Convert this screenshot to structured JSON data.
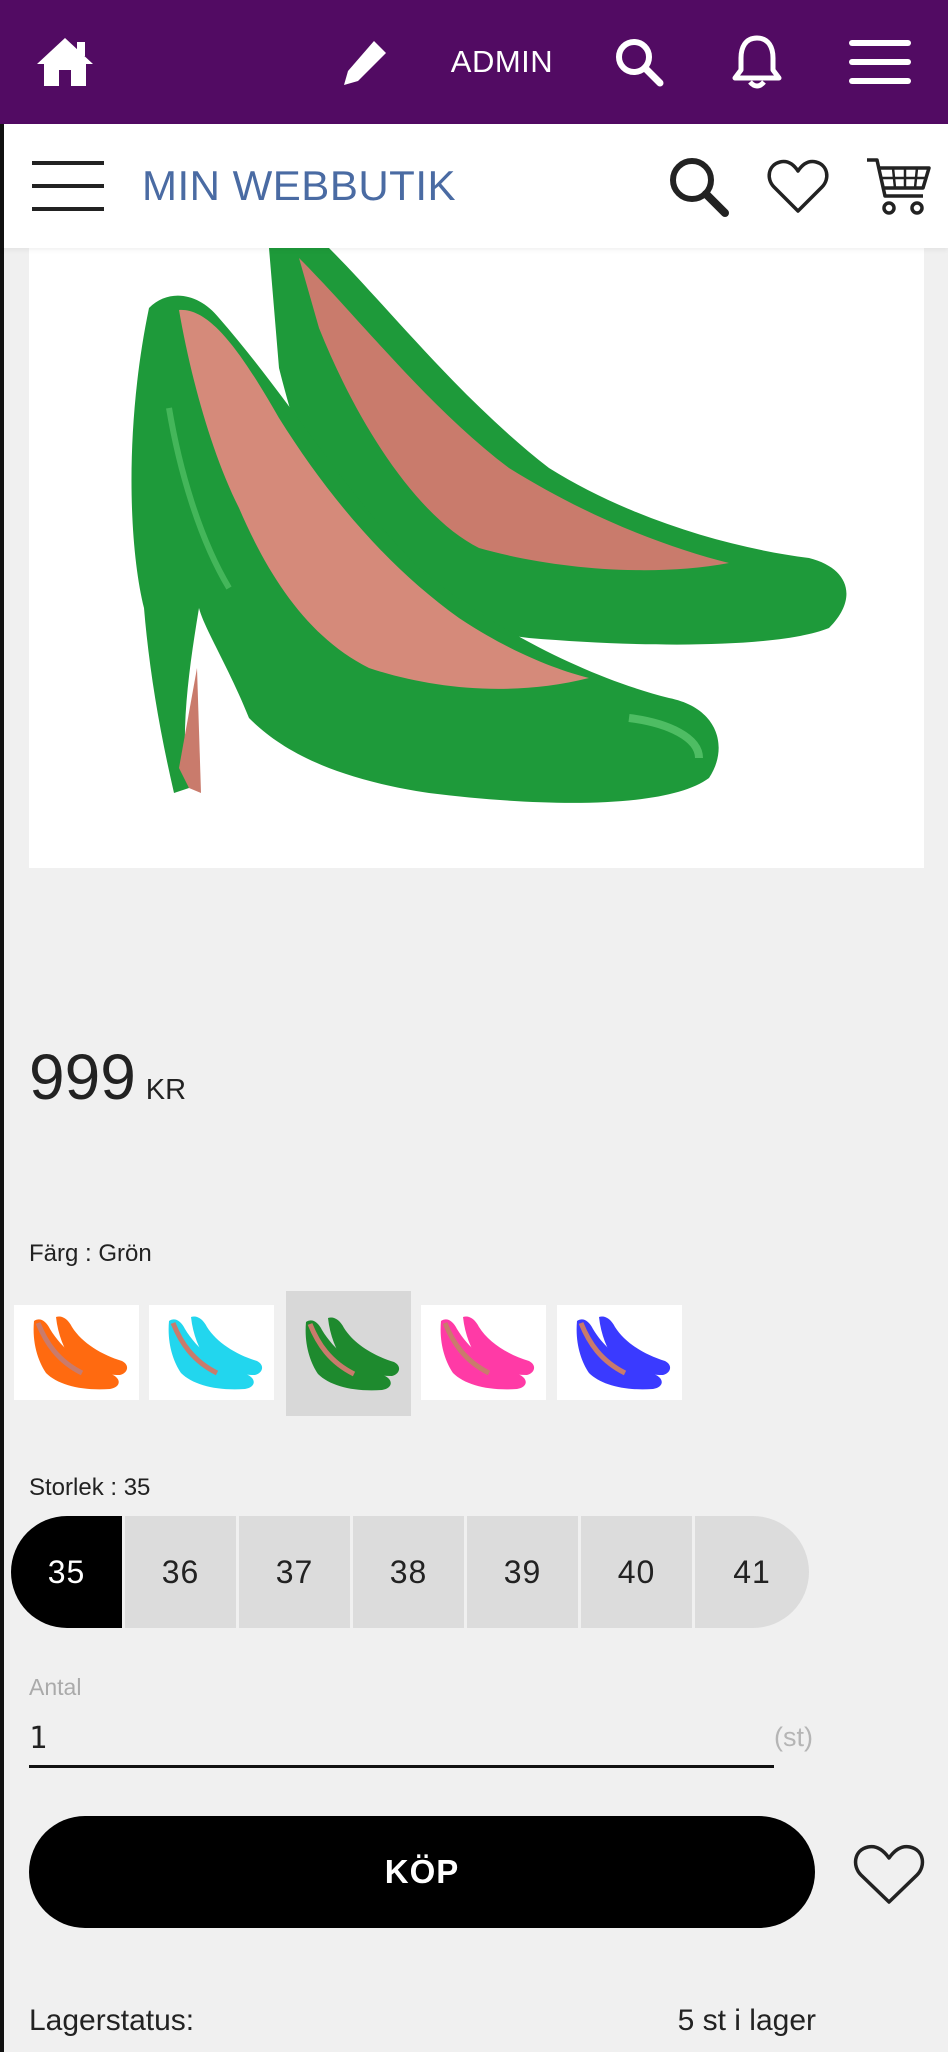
{
  "admin_bar": {
    "admin_label": "ADMIN",
    "background": "#520b63",
    "icons": [
      "home-icon",
      "pencil-icon",
      "search-icon",
      "bell-icon",
      "menu-icon"
    ]
  },
  "header": {
    "logo_text": "MIN WEBBUTIK",
    "logo_color": "#4a6ba3",
    "icons": [
      "hamburger-icon",
      "search-icon",
      "heart-icon",
      "cart-icon"
    ]
  },
  "product": {
    "price_amount": "999",
    "price_currency": "KR",
    "image_color": "#1e9a3a",
    "color_label": "Färg : Grön",
    "colors": [
      {
        "name": "orange",
        "hex": "#ff6a10"
      },
      {
        "name": "cyan",
        "hex": "#22d6ee"
      },
      {
        "name": "green",
        "hex": "#1e8a2e",
        "selected": true
      },
      {
        "name": "pink",
        "hex": "#ff3aa6"
      },
      {
        "name": "blue",
        "hex": "#3a3aff"
      }
    ],
    "size_label": "Storlek : 35",
    "sizes": [
      "35",
      "36",
      "37",
      "38",
      "39",
      "40",
      "41"
    ],
    "selected_size": "35",
    "quantity_label": "Antal",
    "quantity_value": "1",
    "quantity_unit": "(st)",
    "buy_label": "KÖP",
    "stock_label": "Lagerstatus:",
    "stock_value": "5 st i lager"
  }
}
